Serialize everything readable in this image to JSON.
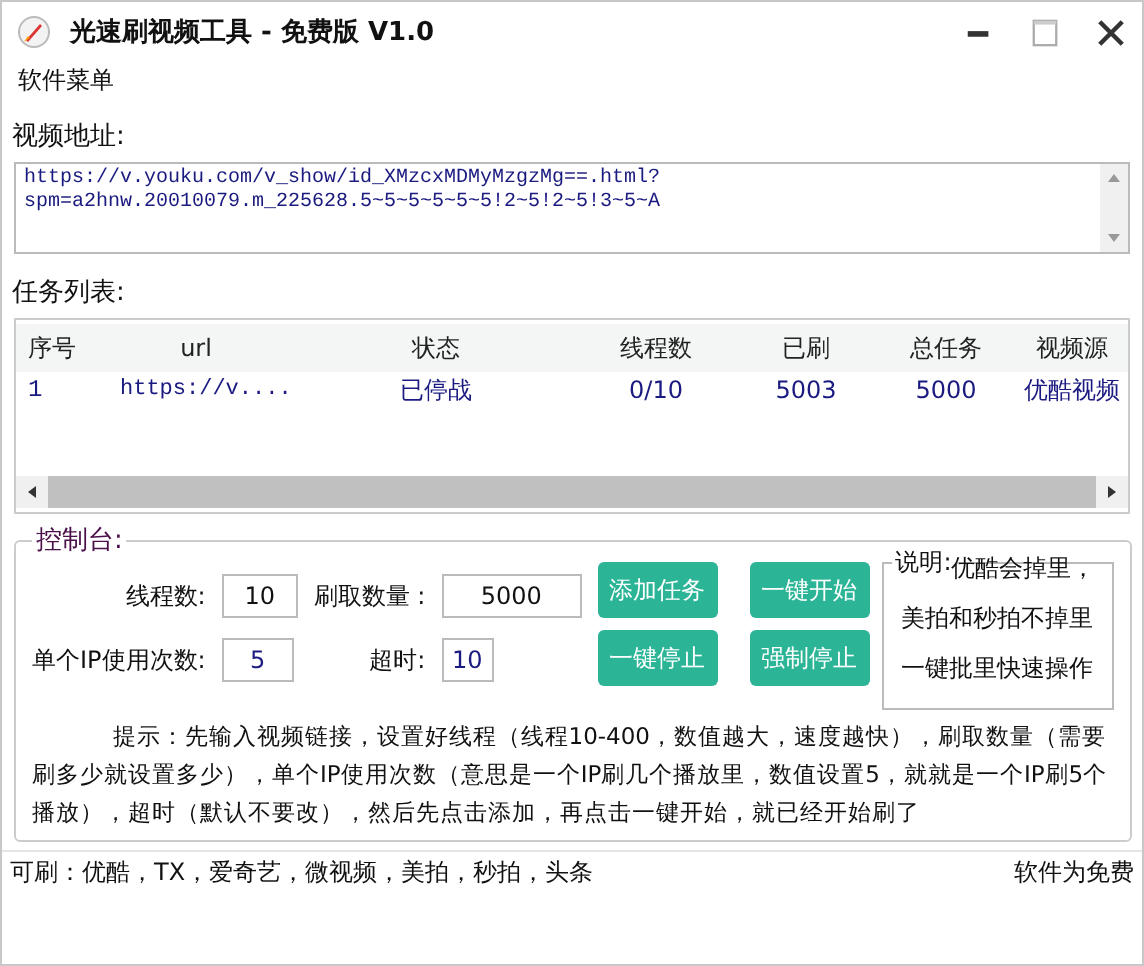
{
  "window": {
    "title": "光速刷视频工具 - 免费版 V1.0"
  },
  "menu": [
    "软件菜单"
  ],
  "url_input": {
    "label": "视频地址:",
    "value": "https://v.youku.com/v_show/id_XMzcxMDMyMzgzMg==.html?spm=a2hnw.20010079.m_225628.5~5~5~5~5~5!2~5!2~5!3~5~A"
  },
  "task_list": {
    "label": "任务列表:",
    "columns": [
      "序号",
      "url",
      "状态",
      "线程数",
      "已刷",
      "总任务",
      "视频源"
    ],
    "rows": [
      {
        "cells": [
          "1",
          "https://v....",
          "已停战",
          "0/10",
          "5003",
          "5000",
          "优酷视频"
        ]
      }
    ]
  },
  "control_panel": {
    "title": "控制台:",
    "fields": [
      {
        "label": "线程数:",
        "value": "10"
      },
      {
        "label": "刷取数量 :",
        "value": "5000"
      },
      {
        "label": "单个IP使用次数:",
        "value": "5"
      },
      {
        "label": "超时:",
        "value": "10"
      }
    ],
    "buttons": [
      "添加任务",
      "一键开始",
      "一键停止",
      "强制停止"
    ],
    "note": {
      "title": "说明:",
      "lines": [
        "优酷会掉里，",
        "美拍和秒拍不掉里",
        "一键批里快速操作"
      ]
    },
    "hint": "提示：先输入视频链接，设置好线程（线程10-400，数值越大，速度越快），刷取数量（需要刷多少就设置多少），单个IP使用次数（意思是一个IP刷几个播放里，数值设置5，就就是一个IP刷5个播放），超时（默认不要改），然后先点击添加，再点击一键开始，就已经开始刷了"
  },
  "status_bar": {
    "left": "可刷：优酷，TX，爱奇艺，微视频，美拍，秒拍，头条",
    "right": "软件为免费"
  }
}
